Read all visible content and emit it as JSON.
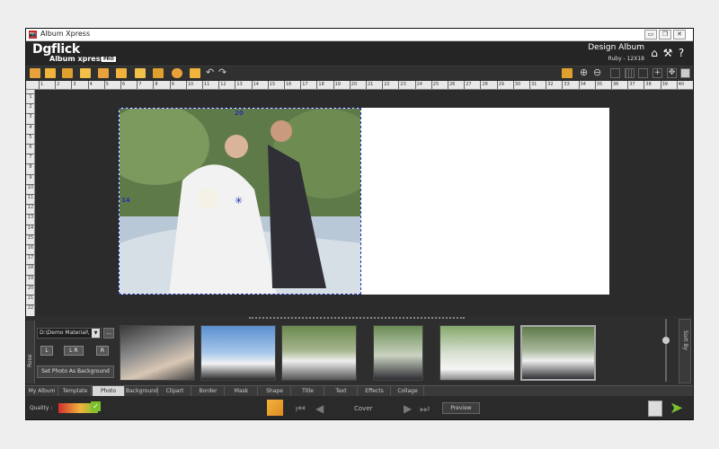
{
  "window": {
    "title": "Album Xpress",
    "controls": [
      "▭",
      "❐",
      "✕"
    ]
  },
  "header": {
    "logo_main": "Dgflick",
    "logo_sub": "Album xpress",
    "logo_badge": "PRO",
    "mode": "Design Album",
    "album_spec": "Ruby - 12X18"
  },
  "rulers": {
    "marks": [
      "1",
      "2",
      "3",
      "4",
      "5",
      "6",
      "7",
      "8",
      "9",
      "10",
      "11",
      "12",
      "13",
      "14",
      "15",
      "16",
      "17",
      "18",
      "19",
      "20",
      "21",
      "22",
      "23",
      "24",
      "25",
      "26",
      "27",
      "28",
      "29",
      "30",
      "31",
      "32",
      "33",
      "34",
      "35",
      "36",
      "37",
      "38",
      "39",
      "40"
    ]
  },
  "canvas": {
    "photo_width_label": "20",
    "photo_height_label": "14"
  },
  "library": {
    "side_tab": "Rose",
    "path": "D:\\Demo Material\\",
    "browse_label": "...",
    "align_left": "L",
    "align_lr": "L R",
    "align_right": "R",
    "set_bg_button": "Set Photo As Background",
    "sort_label": "Sort By"
  },
  "tabs": [
    "My Album",
    "Template",
    "Photo",
    "Background",
    "Clipart",
    "Border",
    "Mask",
    "Shape",
    "Title",
    "Text",
    "Effects",
    "Collage"
  ],
  "active_tab": "Photo",
  "status": {
    "quality_label": "Quality :",
    "page_label": "Cover",
    "preview_button": "Preview"
  },
  "colors": {
    "accent": "#d32f2f",
    "selection": "#2233aa",
    "next_arrow": "#7cc02c"
  }
}
